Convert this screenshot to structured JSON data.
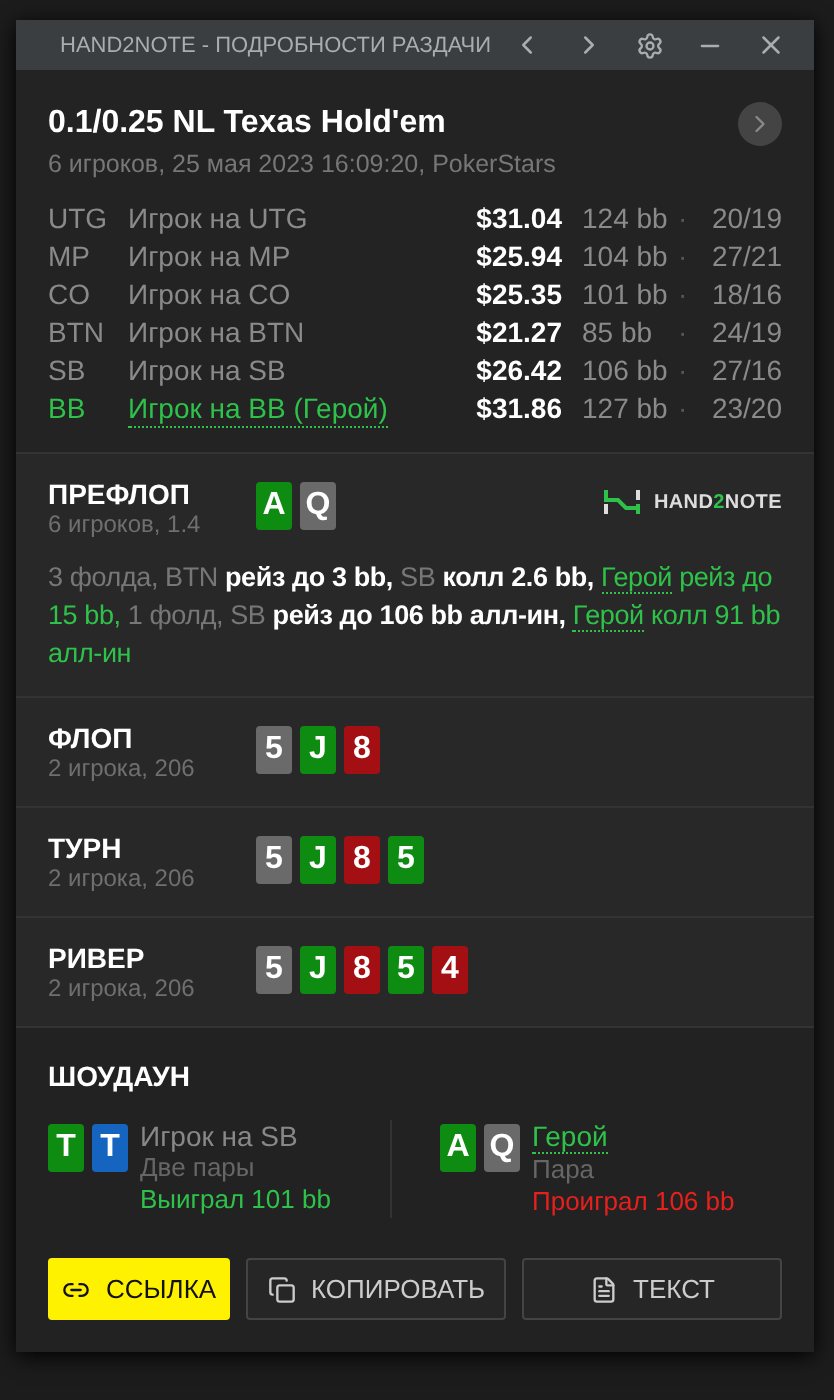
{
  "window": {
    "title": "HAND2NOTE - ПОДРОБНОСТИ РАЗДАЧИ"
  },
  "header": {
    "title": "0.1/0.25 NL Texas Hold'em",
    "subtitle": "6 игроков, 25 мая 2023 16:09:20, PokerStars"
  },
  "players": [
    {
      "position": "UTG",
      "name": "Игрок на UTG",
      "stack": "$31.04",
      "bb": "124 bb",
      "sep": "·",
      "stats": "20/19",
      "hero": false
    },
    {
      "position": "MP",
      "name": "Игрок на MP",
      "stack": "$25.94",
      "bb": "104 bb",
      "sep": "·",
      "stats": "27/21",
      "hero": false
    },
    {
      "position": "CO",
      "name": "Игрок на CO",
      "stack": "$25.35",
      "bb": "101 bb",
      "sep": "·",
      "stats": "18/16",
      "hero": false
    },
    {
      "position": "BTN",
      "name": "Игрок на BTN",
      "stack": "$21.27",
      "bb": "85 bb",
      "sep": "·",
      "stats": "24/19",
      "hero": false
    },
    {
      "position": "SB",
      "name": "Игрок на SB",
      "stack": "$26.42",
      "bb": "106 bb",
      "sep": "·",
      "stats": "27/16",
      "hero": false
    },
    {
      "position": "BB",
      "name": "Игрок на BB (Герой)",
      "stack": "$31.86",
      "bb": "127 bb",
      "sep": "·",
      "stats": "23/20",
      "hero": true
    }
  ],
  "logo": {
    "before": "HAND",
    "accent": "2",
    "after": "NOTE"
  },
  "streets": [
    {
      "name": "ПРЕФЛОП",
      "info": "6 игроков, 1.4",
      "cards": [
        {
          "rank": "A",
          "color": "#0e8c12"
        },
        {
          "rank": "Q",
          "color": "#6a6a6a"
        }
      ],
      "action": [
        {
          "kind": "muted",
          "text": "3 фолда, BTN "
        },
        {
          "kind": "bold",
          "text": "рейз до 3 bb, "
        },
        {
          "kind": "muted",
          "text": "SB "
        },
        {
          "kind": "bold",
          "text": "колл 2.6 bb, "
        },
        {
          "kind": "hero_name",
          "text": "Герой"
        },
        {
          "kind": "hero",
          "text": " рейз до 15 bb, "
        },
        {
          "kind": "muted",
          "text": "1 фолд, SB "
        },
        {
          "kind": "bold",
          "text": "рейз до 106 bb алл-ин, "
        },
        {
          "kind": "hero_name",
          "text": "Герой"
        },
        {
          "kind": "hero",
          "text": " колл 91 bb алл-ин"
        }
      ]
    },
    {
      "name": "ФЛОП",
      "info": "2 игрока, 206",
      "cards": [
        {
          "rank": "5",
          "color": "#6a6a6a"
        },
        {
          "rank": "J",
          "color": "#0e8c12"
        },
        {
          "rank": "8",
          "color": "#a30f12"
        }
      ]
    },
    {
      "name": "ТУРН",
      "info": "2 игрока, 206",
      "cards": [
        {
          "rank": "5",
          "color": "#6a6a6a"
        },
        {
          "rank": "J",
          "color": "#0e8c12"
        },
        {
          "rank": "8",
          "color": "#a30f12"
        },
        {
          "rank": "5",
          "color": "#0e8c12"
        }
      ]
    },
    {
      "name": "РИВЕР",
      "info": "2 игрока, 206",
      "cards": [
        {
          "rank": "5",
          "color": "#6a6a6a"
        },
        {
          "rank": "J",
          "color": "#0e8c12"
        },
        {
          "rank": "8",
          "color": "#a30f12"
        },
        {
          "rank": "5",
          "color": "#0e8c12"
        },
        {
          "rank": "4",
          "color": "#a30f12"
        }
      ]
    }
  ],
  "showdown": {
    "title": "ШОУДАУН",
    "players": [
      {
        "name": "Игрок на SB",
        "hand": "Две пары",
        "result": "Выиграл 101 bb",
        "won": true,
        "hero": false,
        "cards": [
          {
            "rank": "T",
            "color": "#0e8c12"
          },
          {
            "rank": "T",
            "color": "#1565c0"
          }
        ]
      },
      {
        "name": "Герой",
        "hand": "Пара",
        "result": "Проиграл 106 bb",
        "won": false,
        "hero": true,
        "cards": [
          {
            "rank": "A",
            "color": "#0e8c12"
          },
          {
            "rank": "Q",
            "color": "#6a6a6a"
          }
        ]
      }
    ]
  },
  "buttons": [
    {
      "label": "ССЫЛКА",
      "kind": "primary"
    },
    {
      "label": "КОПИРОВАТЬ",
      "kind": "secondary"
    },
    {
      "label": "ТЕКСТ",
      "kind": "secondary"
    }
  ]
}
